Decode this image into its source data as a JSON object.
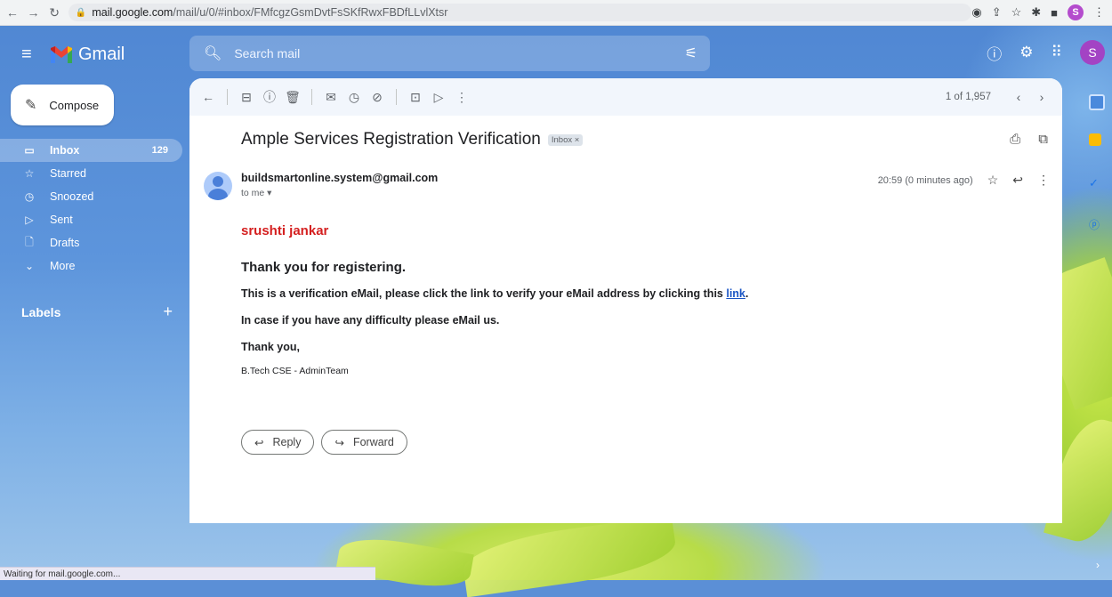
{
  "browser": {
    "url_domain": "mail.google.com",
    "url_path": "/mail/u/0/#inbox/FMfcgzGsmDvtFsSKfRwxFBDfLLvlXtsr",
    "profile_letter": "S"
  },
  "gmail": {
    "app_name": "Gmail",
    "search_placeholder": "Search mail",
    "avatar_letter": "S"
  },
  "sidebar": {
    "compose_label": "Compose",
    "items": [
      {
        "label": "Inbox",
        "count": "129",
        "icon": "inbox-icon"
      },
      {
        "label": "Starred",
        "count": "",
        "icon": "star-icon"
      },
      {
        "label": "Snoozed",
        "count": "",
        "icon": "clock-icon"
      },
      {
        "label": "Sent",
        "count": "",
        "icon": "send-icon"
      },
      {
        "label": "Drafts",
        "count": "",
        "icon": "draft-icon"
      },
      {
        "label": "More",
        "count": "",
        "icon": "chevron-down-icon"
      }
    ],
    "labels_heading": "Labels"
  },
  "toolbar": {
    "pager": "1 of 1,957"
  },
  "email": {
    "subject": "Ample Services Registration Verification",
    "label_chip": "Inbox ×",
    "sender": "buildsmartonline.system@gmail.com",
    "to": "to me ▾",
    "time": "20:59 (0 minutes ago)",
    "body": {
      "name": "srushti jankar",
      "thanks": "Thank you for registering.",
      "line1_prefix": "This is a verification eMail, please click the link to verify your eMail address by clicking this ",
      "line1_link": "link",
      "line1_suffix": ".",
      "line2": "In case if you have any difficulty please eMail us.",
      "closing": "Thank you,",
      "signature": "B.Tech CSE - AdminTeam"
    },
    "reply_label": "Reply",
    "forward_label": "Forward"
  },
  "status_bar": "Waiting for mail.google.com..."
}
